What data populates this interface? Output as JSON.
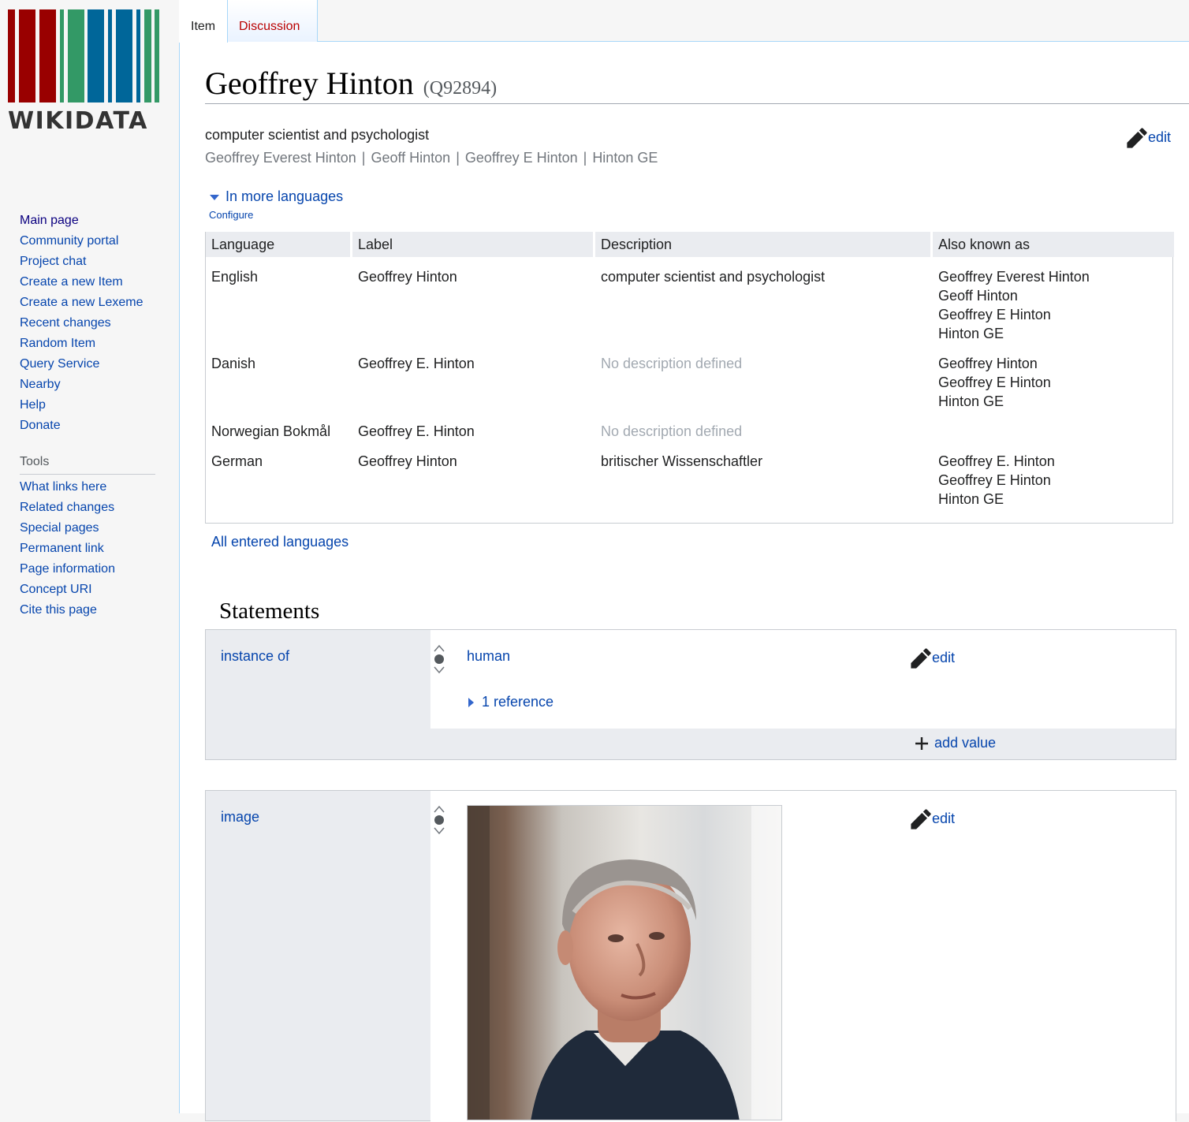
{
  "sidebar": {
    "logo_text": "WIKIDATA",
    "main_nav": [
      "Main page",
      "Community portal",
      "Project chat",
      "Create a new Item",
      "Create a new Lexeme",
      "Recent changes",
      "Random Item",
      "Query Service",
      "Nearby",
      "Help",
      "Donate"
    ],
    "tools_heading": "Tools",
    "tools_nav": [
      "What links here",
      "Related changes",
      "Special pages",
      "Permanent link",
      "Page information",
      "Concept URI",
      "Cite this page"
    ]
  },
  "tabs": {
    "item": "Item",
    "discussion": "Discussion"
  },
  "entity": {
    "title": "Geoffrey Hinton",
    "qid": "(Q92894)",
    "description": "computer scientist and psychologist",
    "aliases": [
      "Geoffrey Everest Hinton",
      "Geoff Hinton",
      "Geoffrey E Hinton",
      "Hinton GE"
    ],
    "alias_separator": "|",
    "edit_label": "edit"
  },
  "languages": {
    "toggle_label": "In more languages",
    "configure_label": "Configure",
    "columns": [
      "Language",
      "Label",
      "Description",
      "Also known as"
    ],
    "rows": [
      {
        "language": "English",
        "label": "Geoffrey Hinton",
        "description": "computer scientist and psychologist",
        "aliases": [
          "Geoffrey Everest Hinton",
          "Geoff Hinton",
          "Geoffrey E Hinton",
          "Hinton GE"
        ]
      },
      {
        "language": "Danish",
        "label": "Geoffrey E. Hinton",
        "description": "No description defined",
        "aliases": [
          "Geoffrey Hinton",
          "Geoffrey E Hinton",
          "Hinton GE"
        ]
      },
      {
        "language": "Norwegian Bokmål",
        "label": "Geoffrey E. Hinton",
        "description": "No description defined",
        "aliases": []
      },
      {
        "language": "German",
        "label": "Geoffrey Hinton",
        "description": "britischer Wissenschaftler",
        "aliases": [
          "Geoffrey E. Hinton",
          "Geoffrey E Hinton",
          "Hinton GE"
        ]
      }
    ],
    "all_languages_label": "All entered languages"
  },
  "statements": {
    "heading": "Statements",
    "instance_of": {
      "property": "instance of",
      "value": "human",
      "edit_label": "edit",
      "reference_label": "1 reference",
      "add_value_label": "add value"
    },
    "image": {
      "property": "image",
      "edit_label": "edit"
    }
  },
  "colors": {
    "link": "#0645ad",
    "discussion_tab": "#ba0000",
    "logo_red": "#990000",
    "logo_green": "#339966",
    "logo_blue": "#006699"
  },
  "icons": [
    "pencil-icon",
    "triangle-down-icon",
    "triangle-right-icon",
    "plus-icon",
    "rank-icon"
  ]
}
